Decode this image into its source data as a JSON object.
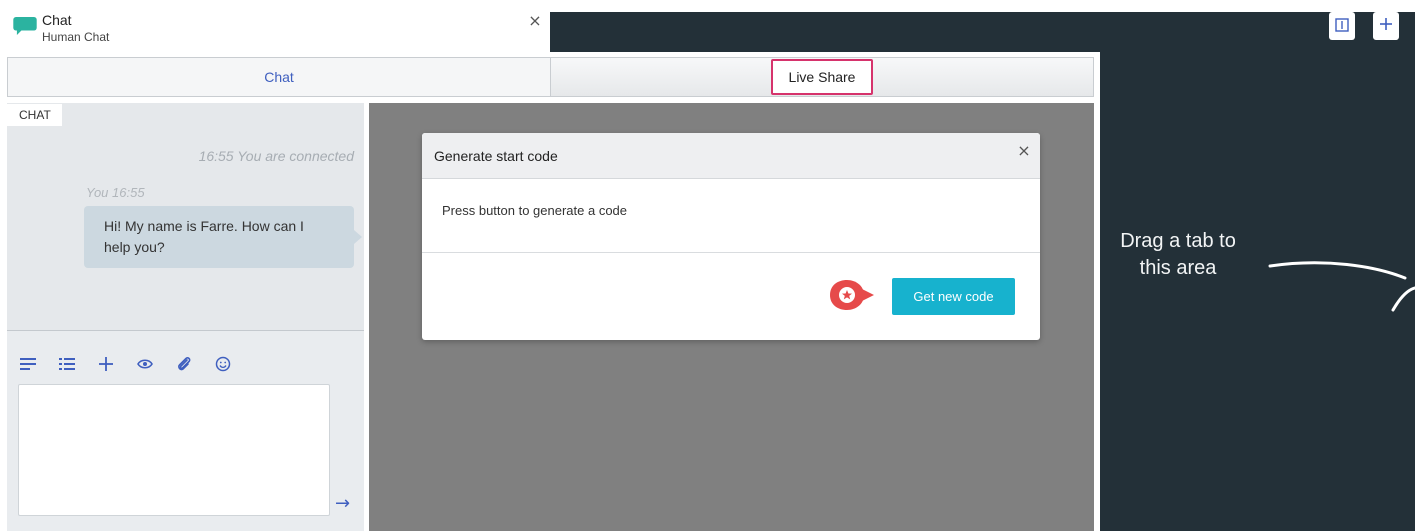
{
  "tab_header": {
    "title": "Chat",
    "subtitle": "Human Chat",
    "close_glyph": "×"
  },
  "tabs": [
    {
      "label": "Chat"
    },
    {
      "label": "Live Share"
    }
  ],
  "chat": {
    "section_label": "CHAT",
    "system_message": "16:55 You are connected",
    "sender_time": "You 16:55",
    "message": "Hi! My name is Farre. How can I help you?",
    "send_glyph": "→"
  },
  "toolbar": {
    "icons": [
      "align-left-icon",
      "list-icon",
      "plus-icon",
      "eye-icon",
      "attachment-icon",
      "smiley-icon"
    ]
  },
  "modal": {
    "title": "Generate start code",
    "close_glyph": "×",
    "body": "Press button to generate a code",
    "button_label": "Get new code"
  },
  "dock": {
    "hint": "Drag a tab to this area"
  },
  "colors": {
    "accent_blue": "#3f5fbf",
    "button_teal": "#17b2ce",
    "dark_panel": "#233038",
    "highlight_pink": "#d6336c",
    "marker_red": "#e64a4a",
    "chat_logo": "#2bb3a0"
  }
}
